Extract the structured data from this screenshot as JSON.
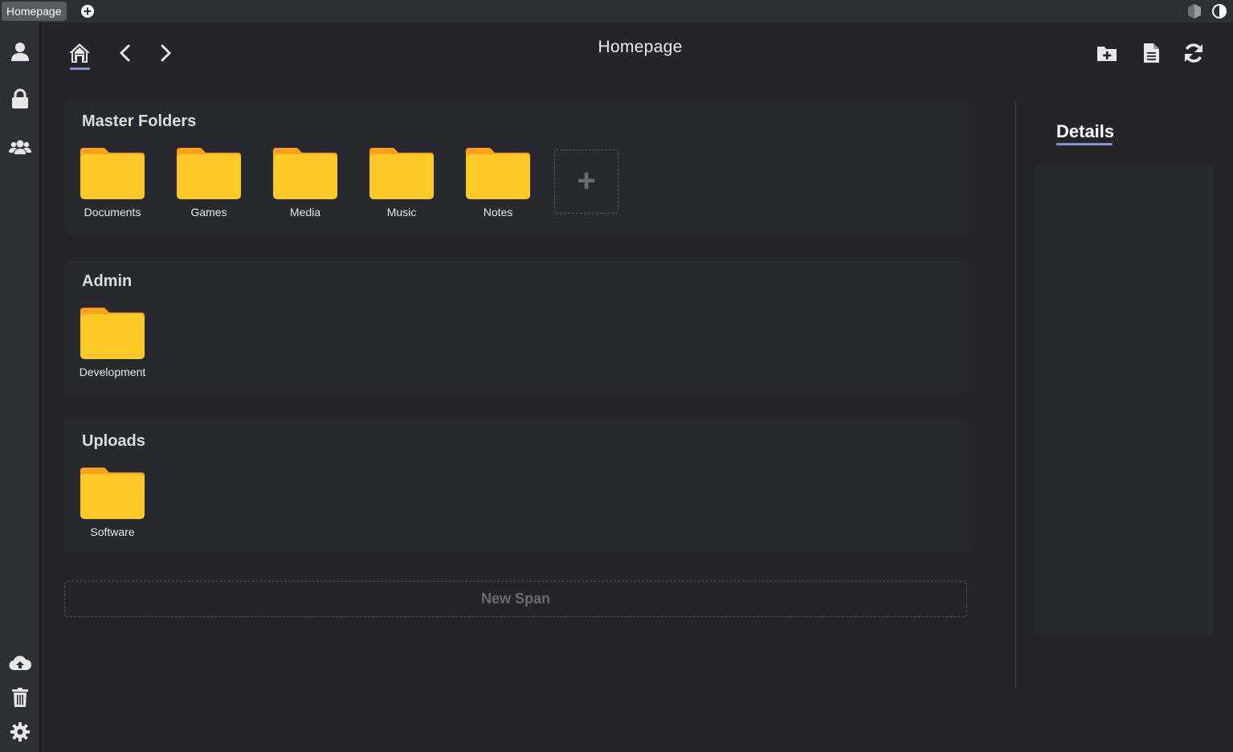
{
  "tabbar": {
    "active_tab": "Homepage"
  },
  "header": {
    "title": "Homepage"
  },
  "spans": [
    {
      "title": "Master Folders",
      "folders": [
        "Documents",
        "Games",
        "Media",
        "Music",
        "Notes"
      ],
      "add_symbol": "+"
    },
    {
      "title": "Admin",
      "folders": [
        "Development"
      ]
    },
    {
      "title": "Uploads",
      "folders": [
        "Software"
      ]
    }
  ],
  "new_span_label": "New Span",
  "details": {
    "title": "Details"
  },
  "colors": {
    "accent": "#8b8fd6",
    "folder": "#ffc928",
    "folder_tab": "#ffa21a",
    "background": "#242429",
    "panel": "#28292e"
  },
  "icons": {
    "rail_top": [
      "user-icon",
      "lock-icon",
      "users-icon"
    ],
    "rail_bottom": [
      "cloud-upload-icon",
      "trash-icon",
      "gear-icon"
    ],
    "header_actions": [
      "new-folder-icon",
      "new-file-icon",
      "refresh-icon"
    ]
  }
}
